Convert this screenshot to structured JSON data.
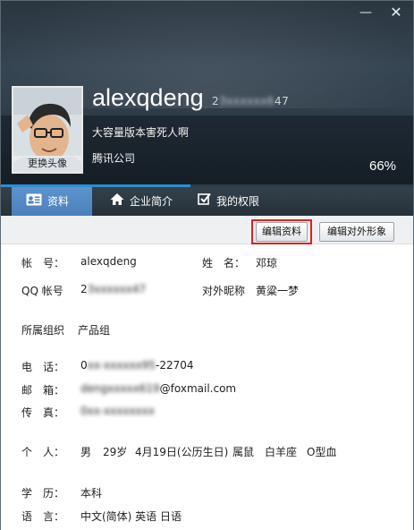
{
  "window": {
    "min_icon": "minimize-icon",
    "close_icon": "close-icon"
  },
  "profile": {
    "username": "alexqdeng",
    "qq_number_visible_prefix": "2",
    "qq_number_blurred": "3xxxxxx6",
    "qq_number_visible_suffix": "47",
    "signature": "大容量版本害死人啊",
    "company": "腾讯公司",
    "completion": "66%",
    "change_avatar_label": "更换头像"
  },
  "tabs": [
    {
      "label": "资料",
      "icon": "profile-card-icon",
      "active": true
    },
    {
      "label": "企业简介",
      "icon": "home-icon",
      "active": false
    },
    {
      "label": "我的权限",
      "icon": "checkbox-icon",
      "active": false
    }
  ],
  "toolbar": {
    "edit_label": "编辑资料",
    "edit_public_label": "编辑对外形象"
  },
  "fields": {
    "account": {
      "label": "帐　号：",
      "value": "alexqdeng"
    },
    "surname": {
      "label": "姓　名：",
      "value": "邓琼"
    },
    "qq": {
      "label": "QQ 帐号",
      "value_prefix": "2",
      "value_blurred": "3xxxxxx47"
    },
    "nickname": {
      "label": "对外昵称",
      "value": "黄粱一梦"
    },
    "org": {
      "label": "所属组织",
      "value": "产品组"
    },
    "phone": {
      "label": "电　话：",
      "value_prefix": "0",
      "value_blurred": "xx-xxxxxx95",
      "value_suffix": "-22704"
    },
    "email": {
      "label": "邮　箱：",
      "value_blurred": "dengxxxxx619",
      "value_suffix": "@foxmail.com"
    },
    "fax": {
      "label": "传　真：",
      "value_blurred": "0xx-xxxxxxxx"
    },
    "personal": {
      "label": "个　人：",
      "gender": "男",
      "age": "29岁",
      "birthday": "4月19日(公历生日)",
      "zodiac": "属鼠",
      "star": "白羊座",
      "blood": "O型血"
    },
    "education": {
      "label": "学　历：",
      "value": "本科"
    },
    "language": {
      "label": "语　言：",
      "value": "中文(简体) 英语 日语"
    }
  },
  "colors": {
    "header_dark": "#2c3945",
    "tab_active": "#5d93cc",
    "highlight_red": "#e02020",
    "progress_blue": "#2a8fd1"
  }
}
